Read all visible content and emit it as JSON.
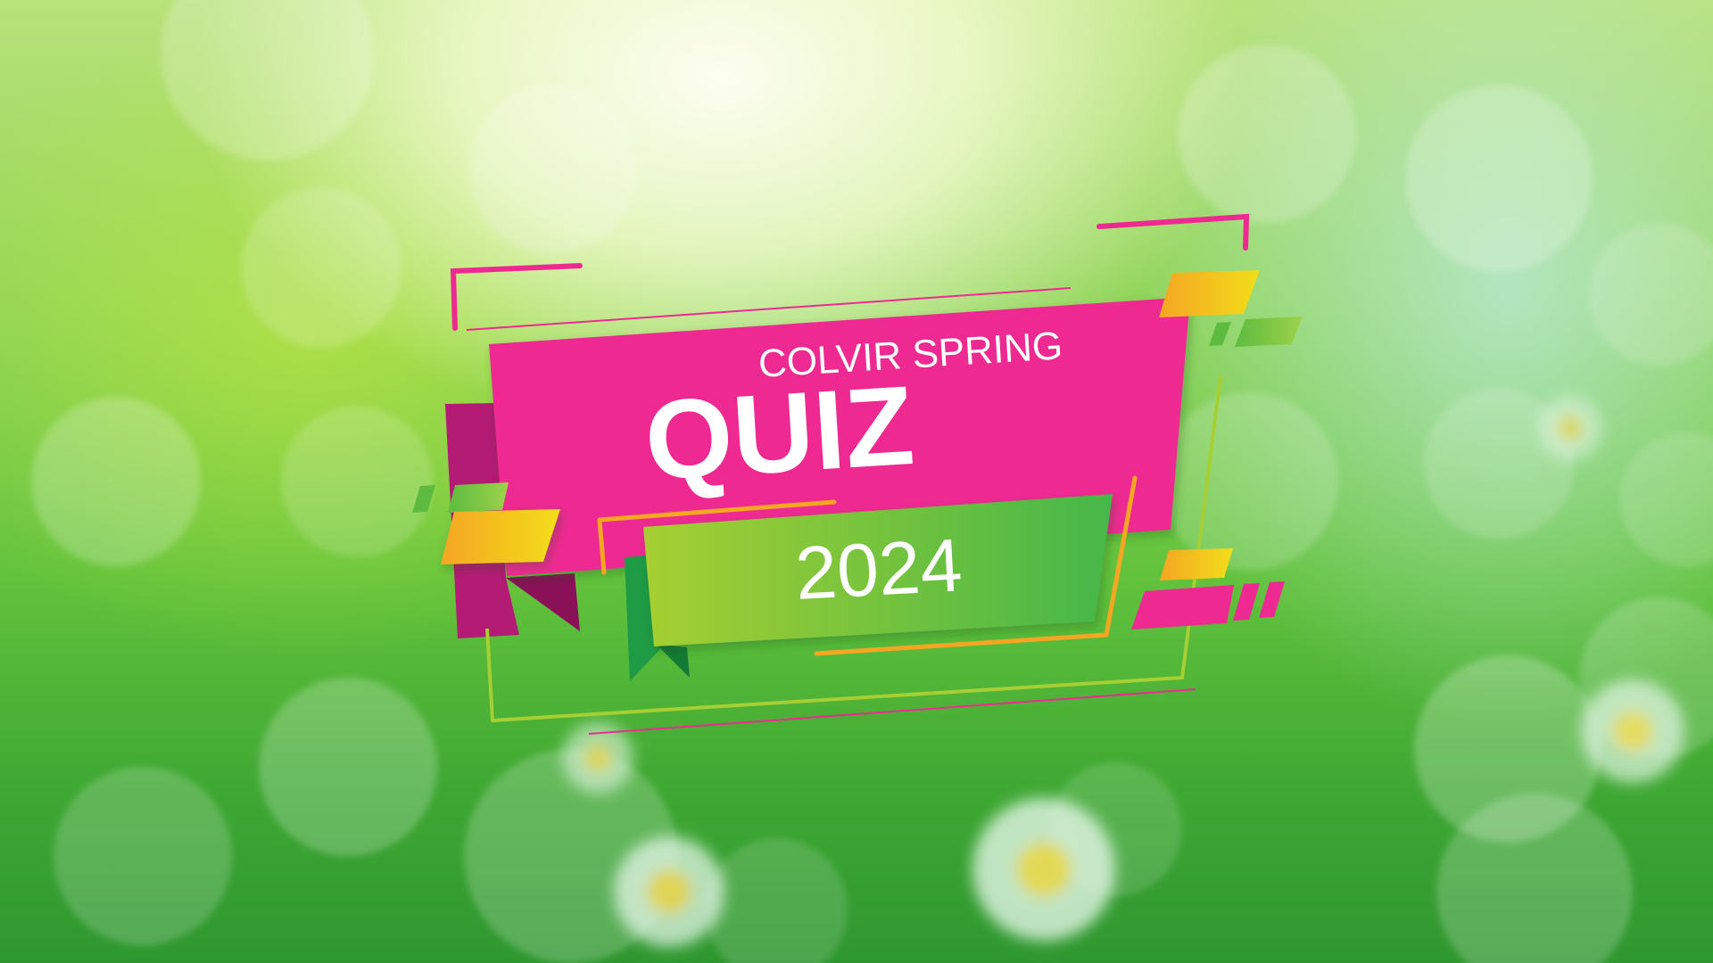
{
  "title": {
    "subtitle": "COLVIR SPRING",
    "main": "QUIZ",
    "year": "2024"
  },
  "colors": {
    "magenta": "#ee2a92",
    "magenta_dark": "#b31b74",
    "green": "#4dba46",
    "lime": "#a5cf32",
    "orange": "#f5a623",
    "yellow": "#f2dc1c"
  }
}
